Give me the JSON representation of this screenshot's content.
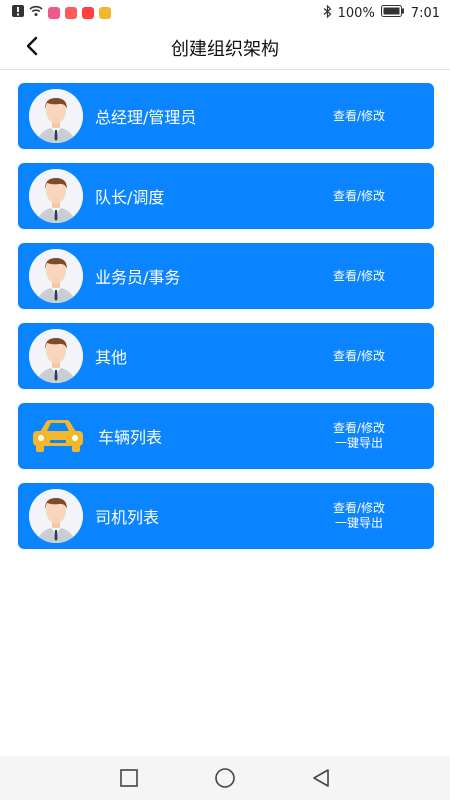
{
  "status_bar": {
    "battery": "100%",
    "time": "7:01",
    "app_icon_colors": [
      "#f05a8a",
      "#ff5a5a",
      "#ff4040",
      "#f2b72b"
    ]
  },
  "header": {
    "title": "创建组织架构"
  },
  "items": [
    {
      "label": "总经理/管理员",
      "icon": "user-avatar-icon",
      "actions": [
        "查看/修改"
      ]
    },
    {
      "label": "队长/调度",
      "icon": "user-avatar-icon",
      "actions": [
        "查看/修改"
      ]
    },
    {
      "label": "业务员/事务",
      "icon": "user-avatar-icon",
      "actions": [
        "查看/修改"
      ]
    },
    {
      "label": "其他",
      "icon": "user-avatar-icon",
      "actions": [
        "查看/修改"
      ]
    },
    {
      "label": "车辆列表",
      "icon": "car-icon",
      "actions": [
        "查看/修改",
        "一键导出"
      ]
    },
    {
      "label": "司机列表",
      "icon": "user-avatar-icon",
      "actions": [
        "查看/修改",
        "一键导出"
      ]
    }
  ],
  "colors": {
    "card_background": "#0a84ff",
    "card_text": "#ffffff",
    "car_color": "#f2b72b"
  }
}
